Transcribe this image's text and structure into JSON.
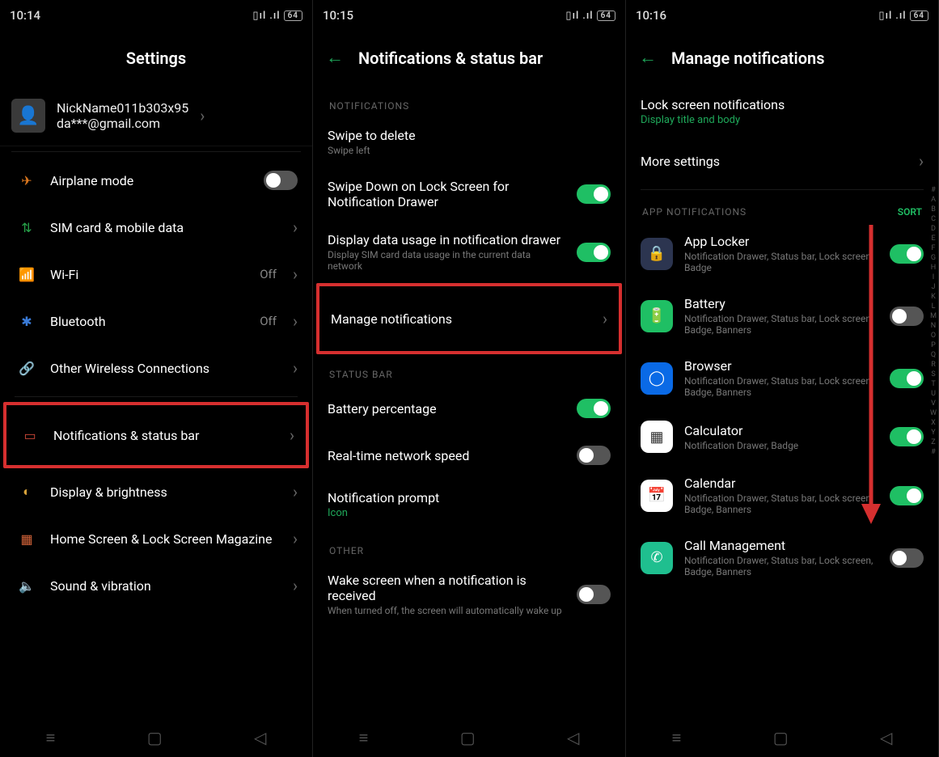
{
  "screen1": {
    "time": "10:14",
    "battery": "64",
    "title": "Settings",
    "profile": {
      "name": "NickName011b303x95",
      "email": "da***@gmail.com"
    },
    "items": [
      {
        "label": "Airplane mode",
        "icon": "airplane-icon",
        "toggle": "off"
      },
      {
        "label": "SIM card & mobile data",
        "icon": "sim-icon",
        "chevron": true
      },
      {
        "label": "Wi-Fi",
        "icon": "wifi-icon",
        "value": "Off",
        "chevron": true
      },
      {
        "label": "Bluetooth",
        "icon": "bluetooth-icon",
        "value": "Off",
        "chevron": true
      },
      {
        "label": "Other Wireless Connections",
        "icon": "wireless-icon",
        "chevron": true
      },
      {
        "label": "Notifications & status bar",
        "icon": "notification-icon",
        "chevron": true,
        "highlight": true
      },
      {
        "label": "Display & brightness",
        "icon": "brightness-icon",
        "chevron": true
      },
      {
        "label": "Home Screen & Lock Screen Magazine",
        "icon": "homescreen-icon",
        "chevron": true
      },
      {
        "label": "Sound & vibration",
        "icon": "sound-icon",
        "chevron": true
      }
    ]
  },
  "screen2": {
    "time": "10:15",
    "battery": "64",
    "title": "Notifications & status bar",
    "section_notifications": "NOTIFICATIONS",
    "section_statusbar": "STATUS BAR",
    "section_other": "OTHER",
    "rows": {
      "swipe_delete": {
        "title": "Swipe to delete",
        "sub": "Swipe left"
      },
      "swipe_down": {
        "title": "Swipe Down on Lock Screen for Notification Drawer",
        "toggle": "on"
      },
      "data_usage": {
        "title": "Display data usage in notification drawer",
        "sub": "Display SIM card data usage in the current data network",
        "toggle": "on"
      },
      "manage": {
        "title": "Manage notifications",
        "chevron": true,
        "highlight": true
      },
      "battery_pct": {
        "title": "Battery percentage",
        "toggle": "on"
      },
      "net_speed": {
        "title": "Real-time network speed",
        "toggle": "off"
      },
      "notif_prompt": {
        "title": "Notification prompt",
        "sub_green": "Icon"
      },
      "wake": {
        "title": "Wake screen when a notification is received",
        "sub": "When turned off, the screen will automatically wake up",
        "toggle": "off"
      }
    }
  },
  "screen3": {
    "time": "10:16",
    "battery": "64",
    "title": "Manage notifications",
    "lock_screen": {
      "title": "Lock screen notifications",
      "sub": "Display title and body"
    },
    "more_settings": "More settings",
    "section_app": "APP NOTIFICATIONS",
    "sort_label": "SORT",
    "apps": [
      {
        "name": "App Locker",
        "sub": "Notification Drawer, Status bar, Lock screen, Badge",
        "bg": "#2c3550",
        "toggle": "on"
      },
      {
        "name": "Battery",
        "sub": "Notification Drawer, Status bar, Lock screen, Badge, Banners",
        "bg": "#1fbf64",
        "toggle": "off"
      },
      {
        "name": "Browser",
        "sub": "Notification Drawer, Status bar, Lock screen, Badge, Banners",
        "bg": "#0a6ae6",
        "toggle": "on"
      },
      {
        "name": "Calculator",
        "sub": "Notification Drawer, Badge",
        "bg": "#ffffff",
        "toggle": "on"
      },
      {
        "name": "Calendar",
        "sub": "Notification Drawer, Status bar, Lock screen, Badge, Banners",
        "bg": "#ffffff",
        "toggle": "on"
      },
      {
        "name": "Call Management",
        "sub": "Notification Drawer, Status bar, Lock screen, Badge, Banners",
        "bg": "#1fbf8f",
        "toggle": "off"
      }
    ],
    "alpha_index": [
      "#",
      "A",
      "B",
      "C",
      "D",
      "E",
      "F",
      "G",
      "H",
      "I",
      "J",
      "K",
      "L",
      "M",
      "N",
      "O",
      "P",
      "Q",
      "R",
      "S",
      "T",
      "U",
      "V",
      "W",
      "X",
      "Y",
      "Z",
      "#"
    ]
  }
}
